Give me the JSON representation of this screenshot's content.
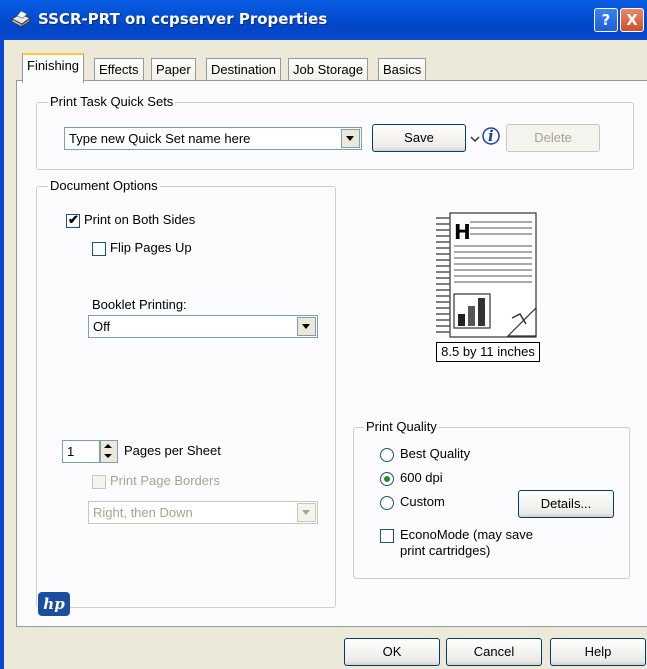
{
  "window": {
    "title": "SSCR-PRT on ccpserver Properties",
    "help_label": "?",
    "close_label": "X"
  },
  "tabs": [
    {
      "label": "Finishing",
      "active": true
    },
    {
      "label": "Effects"
    },
    {
      "label": "Paper"
    },
    {
      "label": "Destination"
    },
    {
      "label": "Job Storage"
    },
    {
      "label": "Basics"
    }
  ],
  "quick_sets": {
    "legend": "Print Task Quick Sets",
    "combo_value": "Type new Quick Set name here",
    "save_label": "Save",
    "info_label": "i",
    "delete_label": "Delete"
  },
  "document_options": {
    "legend": "Document Options",
    "print_both_sides": {
      "label": "Print on Both Sides",
      "checked": true
    },
    "flip_pages_up": {
      "label": "Flip Pages Up",
      "checked": false
    },
    "booklet_label": "Booklet Printing:",
    "booklet_value": "Off",
    "pages_per_sheet_value": "1",
    "pages_per_sheet_label": "Pages per Sheet",
    "print_page_borders": {
      "label": "Print Page Borders",
      "checked": false
    },
    "layout_order_value": "Right, then Down"
  },
  "preview": {
    "letter": "H",
    "size_label": "8.5 by 11 inches"
  },
  "print_quality": {
    "legend": "Print Quality",
    "options": [
      {
        "label": "Best Quality",
        "selected": false
      },
      {
        "label": "600 dpi",
        "selected": true
      },
      {
        "label": "Custom",
        "selected": false
      }
    ],
    "details_label": "Details...",
    "economode_label_1": "EconoMode (may save",
    "economode_label_2": "print cartridges)"
  },
  "logo_text": "hp",
  "footer": {
    "ok_label": "OK",
    "cancel_label": "Cancel",
    "help_label": "Help"
  },
  "colors": {
    "titlebar": "#0245C6",
    "window_bg": "#ECE9D8",
    "tab_highlight": "#FFC83C",
    "hp_blue": "#1A4FA0"
  }
}
